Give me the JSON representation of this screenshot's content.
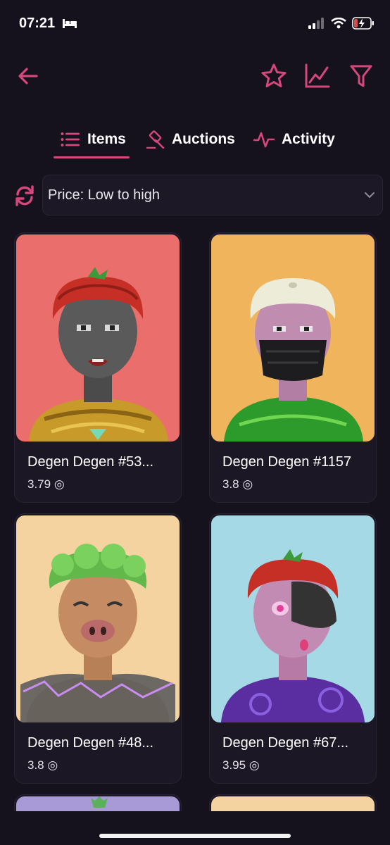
{
  "status_bar": {
    "time": "07:21"
  },
  "tabs": [
    {
      "label": "Items"
    },
    {
      "label": "Auctions"
    },
    {
      "label": "Activity"
    }
  ],
  "sort": {
    "selected": "Price: Low to high"
  },
  "items": [
    {
      "name": "Degen Degen #53...",
      "price": "3.79",
      "currency_symbol": "◎",
      "bg": "#ea6f6c"
    },
    {
      "name": "Degen Degen #1157",
      "price": "3.8",
      "currency_symbol": "◎",
      "bg": "#efb45c"
    },
    {
      "name": "Degen Degen #48...",
      "price": "3.8",
      "currency_symbol": "◎",
      "bg": "#f5d3a0"
    },
    {
      "name": "Degen Degen #67...",
      "price": "3.95",
      "currency_symbol": "◎",
      "bg": "#a6d9e6"
    }
  ],
  "colors": {
    "accent": "#d6487d",
    "background": "#15111d"
  }
}
